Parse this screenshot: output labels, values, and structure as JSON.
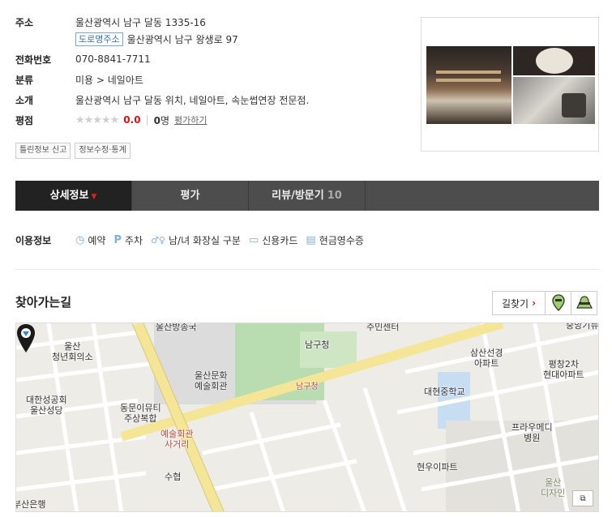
{
  "info": {
    "address_label": "주소",
    "address": "울산광역시 남구 달동 1335-16",
    "road_tag": "도로명주소",
    "road_address": "울산광역시 남구 왕생로 97",
    "phone_label": "전화번호",
    "phone": "070-8841-7711",
    "category_label": "분류",
    "category": "미용 > 네일아트",
    "intro_label": "소개",
    "intro": "울산광역시 남구 달동 위치, 네일아트, 속눈썹연장 전문점.",
    "rating_label": "평점",
    "stars": "★★★★★",
    "score": "0.0",
    "count_num": "0",
    "count_unit": "명",
    "rate_link": "평가하기",
    "report_btn": "틀린정보 신고",
    "edit_btn": "정보수정·통계"
  },
  "tabs": [
    {
      "label": "상세정보",
      "caret": "▼"
    },
    {
      "label": "평가"
    },
    {
      "label": "리뷰/방문기",
      "count": "10"
    }
  ],
  "usage": {
    "label": "이용정보",
    "items": [
      {
        "icon": "clock-icon",
        "glyph": "◷",
        "label": "예약"
      },
      {
        "icon": "parking-icon",
        "glyph": "P",
        "label": "주차"
      },
      {
        "icon": "restroom-icon",
        "glyph": "♂♀",
        "label": "남/녀 화장실 구분"
      },
      {
        "icon": "credit-card-icon",
        "glyph": "▭",
        "label": "신용카드"
      },
      {
        "icon": "receipt-icon",
        "glyph": "▤",
        "label": "현금영수증"
      }
    ]
  },
  "directions": {
    "title": "찾아가는길",
    "find_btn": "길찾기",
    "arrow": "›"
  },
  "map": {
    "labels": {
      "broadcast": "울산방송국",
      "youth_center": "울산\n청년회의소",
      "catholic": "대한성공회\n울산성당",
      "arts_center": "울산문화\n예술회관",
      "community": "동문이뮤티\n주상복합",
      "arts_junction": "예술회관\n사거리",
      "district_office": "남구청",
      "district_small": "남구청",
      "center": "주민센터",
      "samsan": "삼산선경\n아파트",
      "pyeongchang": "평창2차\n현대아파트",
      "daehyeon": "대현중학교",
      "hospital": "프라우메디\n병원",
      "hyunwoo": "현우이파트",
      "suhyeop": "수협",
      "bank": "부산은행",
      "design": "울산\n디자인",
      "corner": "중앙기뉴"
    },
    "expand_btn": "⧉"
  },
  "colors": {
    "tab_bg": "#4d4d4d",
    "tab_active": "#222222",
    "accent_red": "#dd1111",
    "road_yellow": "#f7e89a"
  }
}
